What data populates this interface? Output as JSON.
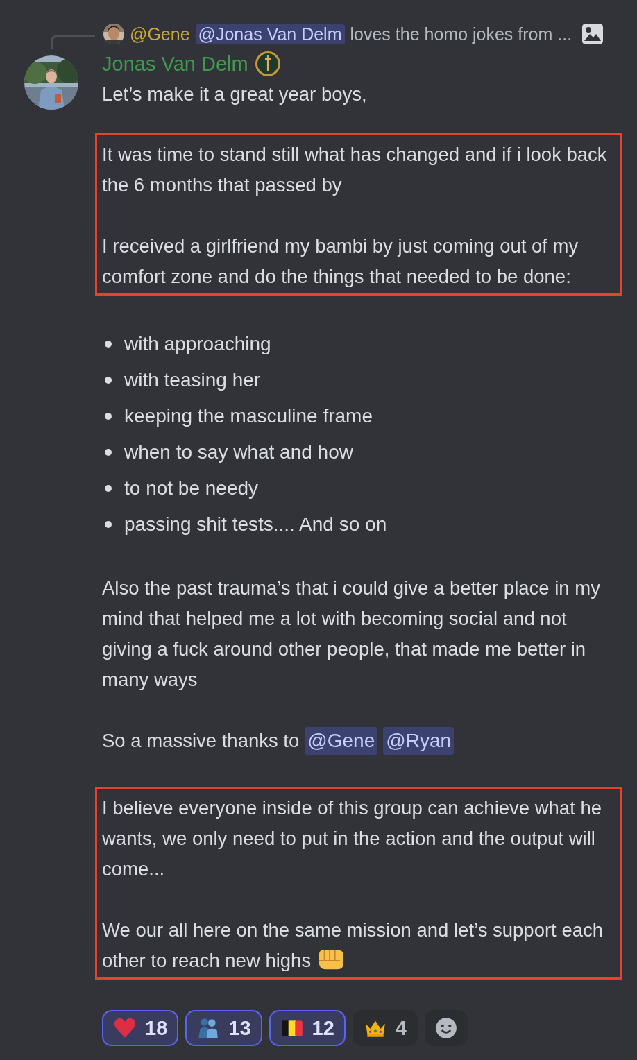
{
  "reply": {
    "author": "@Gene",
    "mention": "@Jonas Van Delm",
    "text": "loves the homo jokes from ..."
  },
  "message": {
    "author": "Jonas Van Delm",
    "blocks": [
      {
        "kind": "paragraph",
        "text": "Let’s make it a great year boys,"
      },
      {
        "kind": "highlight",
        "blocks": [
          {
            "kind": "paragraph",
            "text": "It was time to stand still what has changed and if i look back the 6 months that passed by"
          },
          {
            "kind": "paragraph",
            "text": "I received a girlfriend my bambi by just coming out of my comfort zone and do the things that needed to be done:"
          }
        ]
      },
      {
        "kind": "list",
        "items": [
          "with approaching",
          "with teasing her",
          "keeping the masculine frame",
          "when to say what and how",
          "to not be needy",
          "passing shit tests.... And so on"
        ]
      },
      {
        "kind": "paragraph",
        "text": "Also the past trauma’s that i could give a better place in my mind that helped me a lot with becoming social and not giving a fuck around other people, that made me better in many ways"
      },
      {
        "kind": "mentions",
        "text": "So a massive thanks to",
        "mentions": [
          "@Gene",
          "@Ryan"
        ]
      },
      {
        "kind": "highlight",
        "blocks": [
          {
            "kind": "paragraph",
            "text": "I believe everyone inside of this group can achieve what he wants, we only need to put in the action and the output will come..."
          },
          {
            "kind": "paragraph_with_emoji",
            "text": "We our all here on the same mission and let’s support each other to reach new highs"
          }
        ]
      }
    ],
    "reactions": [
      {
        "kind": "heart",
        "count": "18",
        "selected": true
      },
      {
        "kind": "hug",
        "count": "13",
        "selected": true
      },
      {
        "kind": "flag",
        "count": "12",
        "selected": true
      },
      {
        "kind": "crown",
        "count": "4",
        "selected": false
      }
    ]
  }
}
